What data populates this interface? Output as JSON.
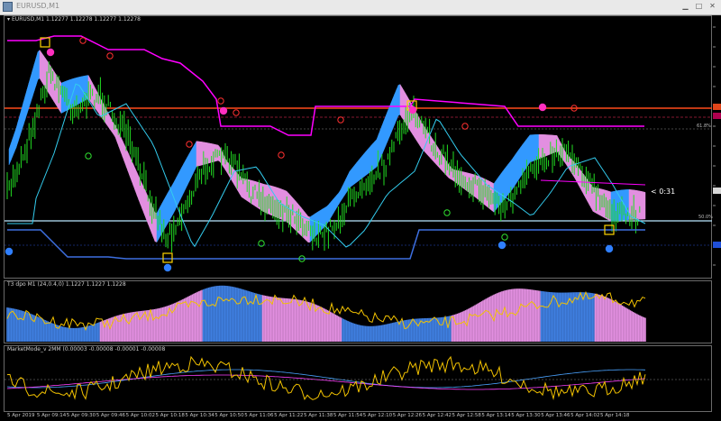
{
  "window": {
    "title": "EURUSD,M1"
  },
  "main_panel": {
    "label": "EURUSD,M1  1.12277 1.12278 1.12277 1.12278",
    "countdown": "< 0:31",
    "fib_upper": "61.8%",
    "fib_lower": "50.0%"
  },
  "t3_panel": {
    "label": "T3 dpo M1 (24,0.4,0) 1.1227 1.1227 1.1228"
  },
  "mm_panel": {
    "label": "MarketMode_v  2MM (0.00003 -0.00008 -0.00001 -0.00008"
  },
  "time_axis": [
    "5 Apr 2019",
    "5 Apr 09:14",
    "5 Apr 09:30",
    "5 Apr 09:46",
    "5 Apr 10:02",
    "5 Apr 10:18",
    "5 Apr 10:34",
    "5 Apr 10:50",
    "5 Apr 11:06",
    "5 Apr 11:22",
    "5 Apr 11:38",
    "5 Apr 11:54",
    "5 Apr 12:10",
    "5 Apr 12:26",
    "5 Apr 12:42",
    "5 Apr 12:58",
    "5 Apr 13:14",
    "5 Apr 13:30",
    "5 Apr 13:46",
    "5 Apr 14:02",
    "5 Apr 14:18"
  ],
  "colors": {
    "candles": "#22dd22",
    "band_up": "#3399ff",
    "band_down": "#e28fe0",
    "channel_upper": "#ff00ff",
    "channel_lower": "#3d6fe0",
    "level_orange": "#ff4a1a",
    "level_white": "#b9e8ff",
    "oscillator": "#f2c200"
  },
  "icons": {
    "minimize": "minimize-icon",
    "maximize": "maximize-icon",
    "close": "close-icon",
    "panel_arrow": "dropdown-arrow-icon"
  },
  "glyphs": {
    "minimize": "▁",
    "maximize": "□",
    "close": "✕",
    "arrow": "▾"
  }
}
